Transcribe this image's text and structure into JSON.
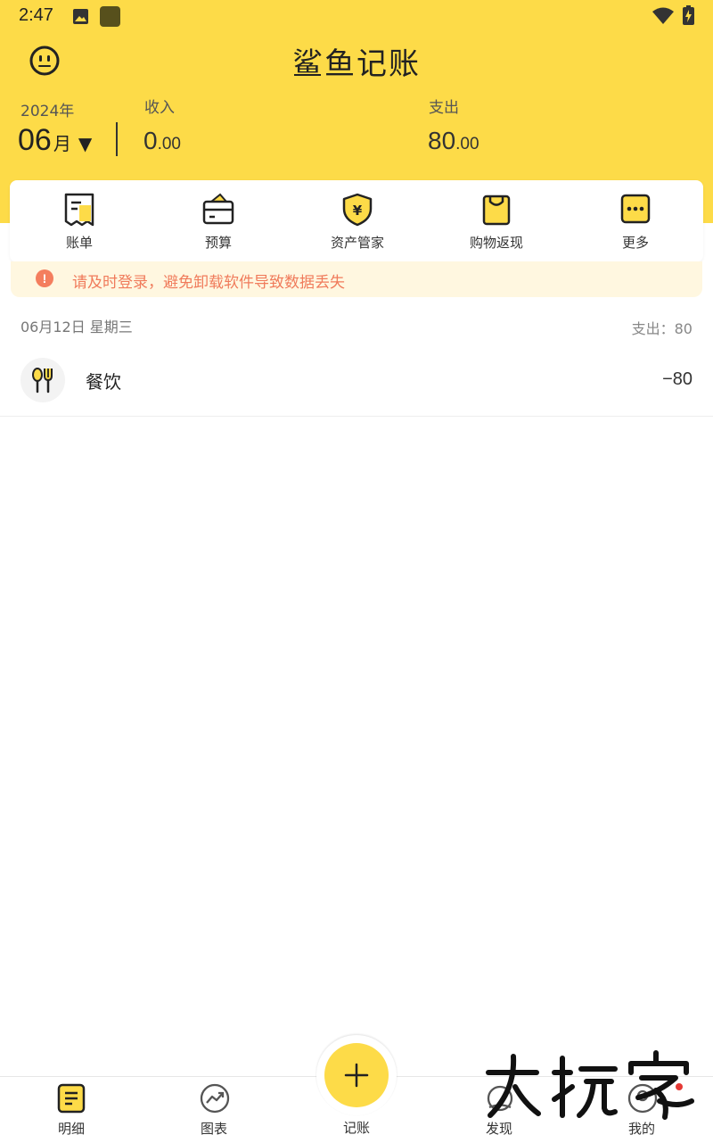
{
  "status_bar": {
    "time": "2:47"
  },
  "app": {
    "title": "鲨鱼记账"
  },
  "summary": {
    "year": "2024年",
    "month": "06",
    "month_unit": "月",
    "income_label": "收入",
    "income_int": "0",
    "income_dec": ".00",
    "expense_label": "支出",
    "expense_int": "80",
    "expense_dec": ".00"
  },
  "toolbar": [
    {
      "label": "账单",
      "icon": "bill-icon"
    },
    {
      "label": "预算",
      "icon": "budget-wallet-icon"
    },
    {
      "label": "资产管家",
      "icon": "asset-shield-icon"
    },
    {
      "label": "购物返现",
      "icon": "shopping-bag-icon"
    },
    {
      "label": "更多",
      "icon": "more-dots-icon"
    }
  ],
  "notice": {
    "text": "请及时登录，避免卸载软件导致数据丢失"
  },
  "day_group": {
    "date": "06月12日 星期三",
    "total": "支出：80",
    "records": [
      {
        "category": "餐饮",
        "amount": "−80",
        "icon": "dining-fork-spoon-icon"
      }
    ]
  },
  "bottom_nav": [
    {
      "label": "明细",
      "icon": "detail-list-icon",
      "active": true
    },
    {
      "label": "图表",
      "icon": "chart-trend-icon"
    },
    {
      "label": "记账",
      "icon": "add-plus-icon"
    },
    {
      "label": "发现",
      "icon": "discover-icon"
    },
    {
      "label": "我的",
      "icon": "profile-icon"
    }
  ],
  "colors": {
    "brand_yellow": "#fddb48",
    "notice_text": "#f07b5b",
    "notice_bg": "#fff7e0"
  }
}
